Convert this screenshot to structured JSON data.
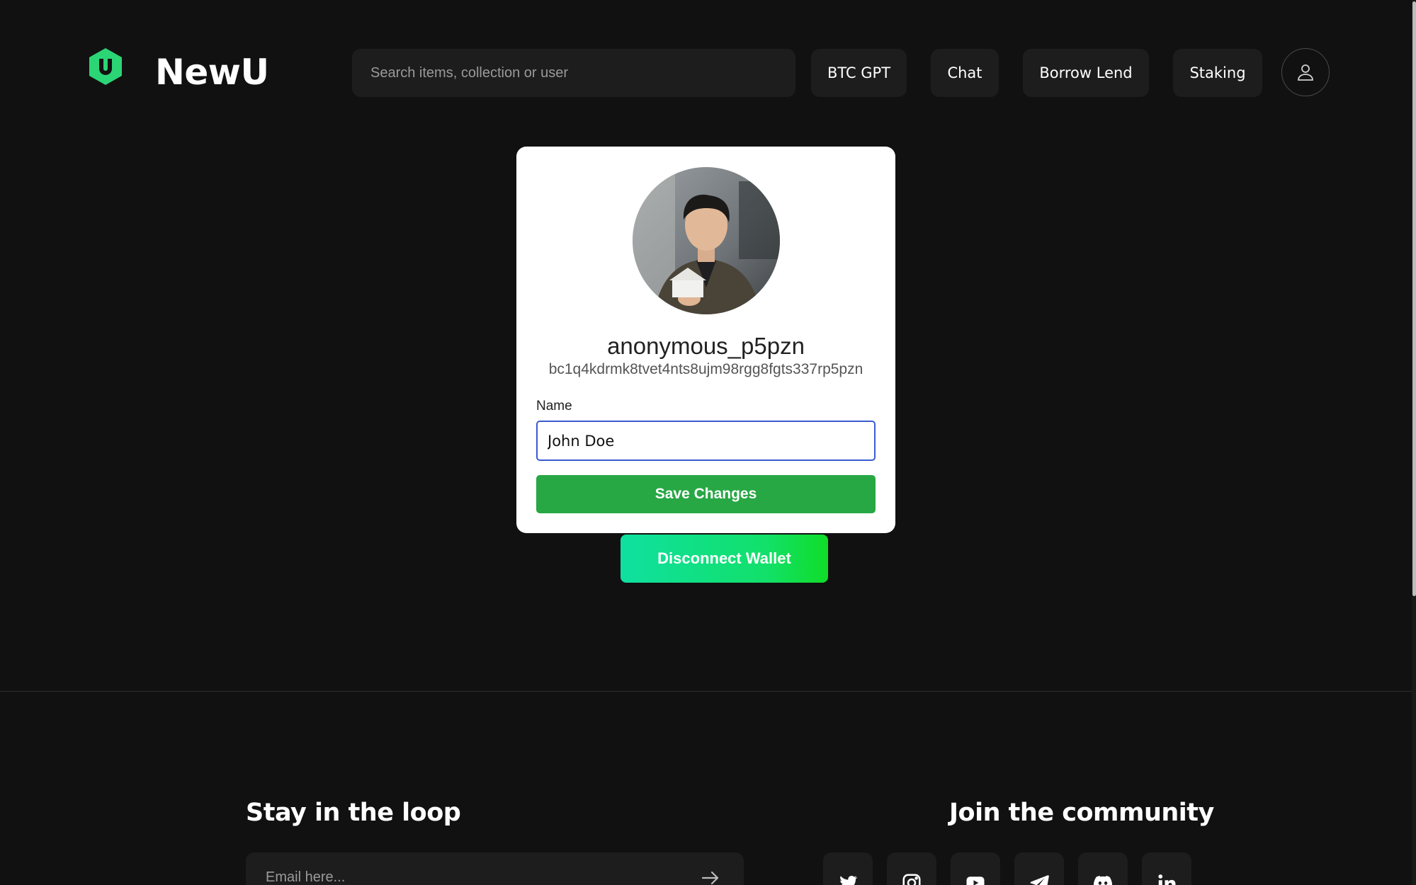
{
  "header": {
    "brand": "NewU",
    "search_placeholder": "Search items, collection or user",
    "nav": {
      "btc_gpt": "BTC GPT",
      "chat": "Chat",
      "borrow_lend": "Borrow Lend",
      "staking": "Staking"
    }
  },
  "profile": {
    "username": "anonymous_p5pzn",
    "wallet_address": "bc1q4kdrmk8tvet4nts8ujm98rgg8fgts337rp5pzn",
    "name_label": "Name",
    "name_value": "John Doe",
    "save_label": "Save Changes",
    "disconnect_label": "Disconnect Wallet"
  },
  "footer": {
    "newsletter_heading": "Stay in the loop",
    "email_placeholder": "Email here...",
    "community_heading": "Join the community",
    "social_icons": [
      "twitter-icon",
      "instagram-icon",
      "youtube-icon",
      "telegram-icon",
      "discord-icon",
      "linkedin-icon"
    ]
  },
  "colors": {
    "background": "#111111",
    "surface": "#1d1d1d",
    "brand_green": "#2bd576",
    "save_green": "#28a745",
    "input_focus": "#3a5bd0"
  }
}
